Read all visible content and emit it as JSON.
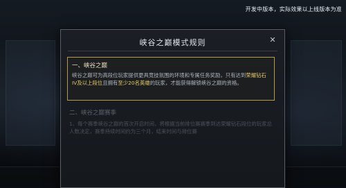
{
  "dev_note": "开发中版本，实际效果以上线版本为准",
  "dialog": {
    "title": "峡谷之巅模式规则",
    "close_symbol": "✕",
    "section1": {
      "title": "一、峡谷之巅",
      "body_part1": "峡谷之巅可为高段位玩家提供更具竞技氛围的环境和专属任务奖励，只有达到",
      "highlight1": "荣耀钻石IV及以上段位",
      "body_part2": "且拥有",
      "highlight2": "至少20名英雄",
      "body_part3": "的玩家，才能获得解锁峡谷之巅的资格。"
    },
    "section2": {
      "title": "二、峡谷之巅赛季",
      "body": "1、每个赛季峡谷之巅的首次开启时间，将根据当前排位赛赛季到达荣耀钻石段位的玩家总人数决定，赛季持续时间约为三个月，结束时间与排位赛"
    }
  },
  "colors": {
    "accent_gold": "#e7c96a",
    "border_gold": "#b89a4a",
    "dialog_bg": "#1b1f25"
  }
}
